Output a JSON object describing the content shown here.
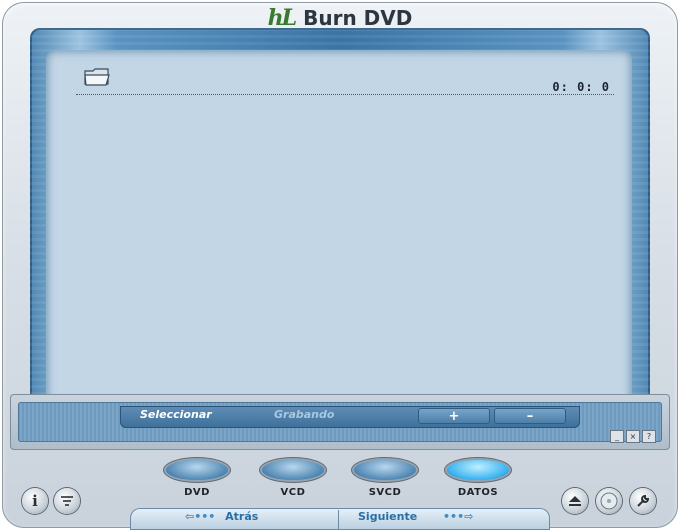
{
  "window": {
    "logo_text": "hL",
    "title": "Burn DVD"
  },
  "content": {
    "time": "0: 0: 0"
  },
  "tabs": [
    {
      "label": "Seleccionar",
      "active": true
    },
    {
      "label": "Grabando",
      "active": false
    }
  ],
  "tab_buttons": {
    "plus": "+",
    "minus": "–"
  },
  "window_buttons": [
    "_",
    "×",
    "?"
  ],
  "modes": [
    {
      "label": "DVD",
      "active": false
    },
    {
      "label": "VCD",
      "active": false
    },
    {
      "label": "SVCD",
      "active": false
    },
    {
      "label": "DATOS",
      "active": true
    }
  ],
  "nav": {
    "prev": "Atrás",
    "next": "Siguiente"
  },
  "icons": {
    "info": "info-icon",
    "filter": "filter-icon",
    "eject": "eject-icon",
    "disc": "disc-icon",
    "tools": "wrench-icon"
  },
  "colors": {
    "active_mode": "#3fb6f2",
    "content_bg": "#c2d6e6",
    "logo": "#3a7a2e"
  }
}
